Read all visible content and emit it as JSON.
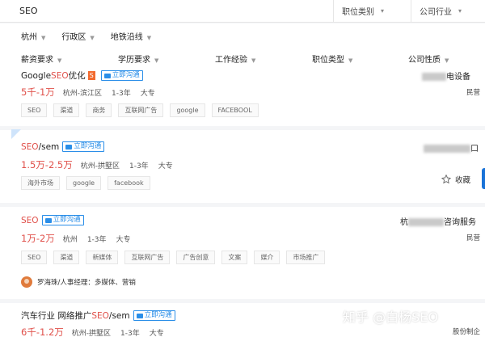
{
  "search": {
    "query": "SEO",
    "category": "职位类别",
    "industry": "公司行业"
  },
  "filters": {
    "row1": [
      "杭州",
      "行政区",
      "地铁沿线"
    ],
    "row2": [
      "薪资要求",
      "学历要求",
      "工作经验",
      "职位类型",
      "公司性质"
    ]
  },
  "jobs": [
    {
      "title_pre": "Google ",
      "title_hl": "SEO",
      "title_post": " 优化",
      "badge": "S",
      "chat": "立即沟通",
      "salary": "5千-1万",
      "location": "杭州-滨江区",
      "experience": "1-3年",
      "education": "大专",
      "tags": [
        "SEO",
        "渠道",
        "商务",
        "互联网广告",
        "google",
        "FACEBOOL"
      ],
      "company_suffix": "电设备",
      "company_type": "民营"
    },
    {
      "title_pre": "",
      "title_hl": "SEO",
      "title_post": "/sem",
      "chat": "立即沟通",
      "salary": "1.5万-2.5万",
      "location": "杭州-拱墅区",
      "experience": "1-3年",
      "education": "大专",
      "tags": [
        "海外市场",
        "google",
        "facebook"
      ],
      "company_suffix": "口",
      "company_type": ""
    },
    {
      "title_pre": "",
      "title_hl": "SEO",
      "title_post": "",
      "chat": "立即沟通",
      "salary": "1万-2万",
      "location": "杭州",
      "experience": "1-3年",
      "education": "大专",
      "tags": [
        "SEO",
        "渠道",
        "新媒体",
        "互联网广告",
        "广告创意",
        "文案",
        "媒介",
        "市场推广"
      ],
      "company_prefix": "杭",
      "company_suffix": "咨询服务",
      "company_type": "民营"
    },
    {
      "title_pre": "汽车行业 网络推广",
      "title_hl": "SEO",
      "title_post": "/sem",
      "chat": "立即沟通",
      "salary": "6千-1.2万",
      "location": "杭州-拱墅区",
      "experience": "1-3年",
      "education": "大专",
      "company_type": "股份制企"
    }
  ],
  "favorite_label": "收藏",
  "recruiter": "罗海珠/人事经理：多媒体、营销",
  "watermark": "知乎 @白杨SEO",
  "colors": {
    "accent_red": "#e0504a",
    "accent_blue": "#2a8ee8",
    "badge_orange": "#f26a2e"
  }
}
